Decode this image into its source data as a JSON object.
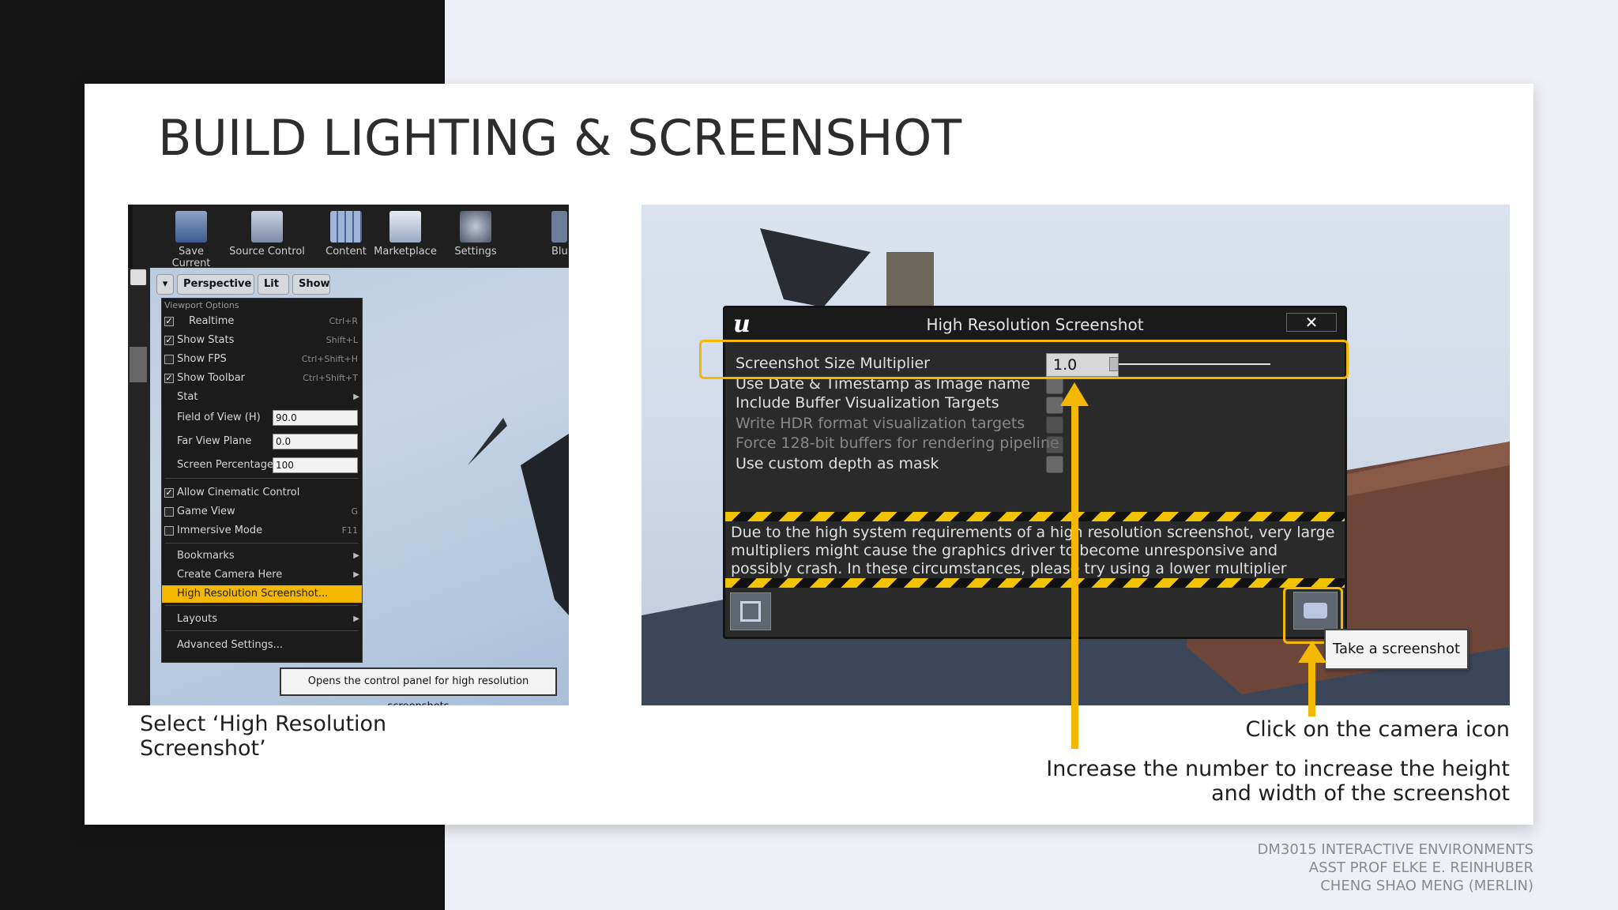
{
  "slide": {
    "title": "BUILD LIGHTING & SCREENSHOT",
    "caption_left": "Select ‘High Resolution Screenshot’",
    "caption_right_1": "Click on the camera icon",
    "caption_right_2": "Increase the number to increase the height and width of the screenshot",
    "footer": [
      "DM3015 INTERACTIVE ENVIRONMENTS",
      "ASST PROF ELKE E. REINHUBER",
      "CHENG SHAO MENG (MERLIN)"
    ]
  },
  "toolbar": {
    "buttons": [
      "Save Current",
      "Source Control",
      "Content",
      "Marketplace",
      "Settings",
      "Blu"
    ]
  },
  "viewport": {
    "mode": "Perspective",
    "lit": "Lit",
    "show": "Show"
  },
  "menu": {
    "header": "Viewport Options",
    "realtime": {
      "label": "Realtime",
      "shortcut": "Ctrl+R",
      "checked": true
    },
    "show_stats": {
      "label": "Show Stats",
      "shortcut": "Shift+L",
      "checked": true
    },
    "show_fps": {
      "label": "Show FPS",
      "shortcut": "Ctrl+Shift+H",
      "checked": false
    },
    "show_toolbar": {
      "label": "Show Toolbar",
      "shortcut": "Ctrl+Shift+T",
      "checked": true
    },
    "stat": "Stat",
    "fov": {
      "label": "Field of View (H)",
      "value": "90.0"
    },
    "far_view": {
      "label": "Far View Plane",
      "value": "0.0"
    },
    "screen_pct": {
      "label": "Screen Percentage",
      "value": "100"
    },
    "cinematic": {
      "label": "Allow Cinematic Control",
      "checked": true
    },
    "game_view": {
      "label": "Game View",
      "shortcut": "G",
      "checked": false
    },
    "immersive": {
      "label": "Immersive Mode",
      "shortcut": "F11",
      "checked": false
    },
    "bookmarks": "Bookmarks",
    "create_camera": "Create Camera Here",
    "high_res": "High Resolution Screenshot...",
    "layouts": "Layouts",
    "advanced": "Advanced Settings...",
    "tooltip": "Opens the control panel for high resolution screenshots"
  },
  "dialog": {
    "title": "High Resolution Screenshot",
    "close": "✕",
    "multiplier_label": "Screenshot Size Multiplier",
    "multiplier_value": "1.0",
    "opt_date": "Use Date & Timestamp as Image name",
    "opt_buffer": "Include Buffer Visualization Targets",
    "opt_hdr": "Write HDR format visualization targets",
    "opt_128": "Force 128-bit buffers for rendering pipeline",
    "opt_depth": "Use custom depth as mask",
    "warning": "Due to the high system requirements of a high resolution screenshot, very large multipliers might cause the graphics driver to become unresponsive and possibly crash. In these circumstances, please try using a lower multiplier",
    "tooltip": "Take a screenshot"
  },
  "colors": {
    "accent": "#f5b800",
    "dark_band": "#141414",
    "dialog_bg": "#2a2a2a"
  }
}
